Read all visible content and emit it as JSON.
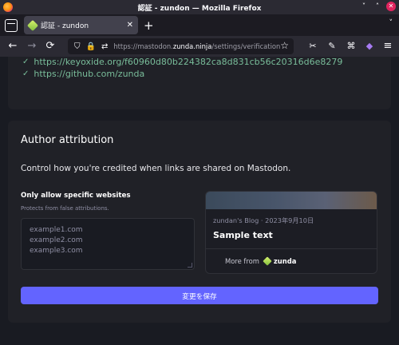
{
  "window": {
    "title": "認証 - zundon — Mozilla Firefox",
    "minimize": "˅",
    "maximize": "˄",
    "close": "✕"
  },
  "tabs": [
    {
      "title": "認証 - zundon",
      "close": "✕"
    }
  ],
  "tabstrip": {
    "new_tab": "+",
    "overflow": "˅"
  },
  "nav": {
    "back": "←",
    "forward": "→",
    "reload": "⟳",
    "url_prefix": "https://mastodon.",
    "url_host": "zunda.ninja",
    "url_path": "/settings/verification",
    "star": "☆",
    "shield": "⛉",
    "lock": "🔒",
    "perm": "⇄",
    "ext1": "✂",
    "ext2": "✎",
    "ext3": "⌘",
    "ext4": "◆",
    "menu": "≡"
  },
  "verified_links": [
    "https://keyoxide.org/f60960d80b224382ca8d831cb56c20316d6e8279",
    "https://github.com/zunda"
  ],
  "author_attribution": {
    "title": "Author attribution",
    "description": "Control how you're credited when links are shared on Mastodon.",
    "field_label": "Only allow specific websites",
    "field_hint": "Protects from false attributions.",
    "placeholder_lines": [
      "example1.com",
      "example2.com",
      "example3.com"
    ],
    "preview": {
      "meta": "zundan's Blog · 2023年9月10日",
      "title": "Sample text",
      "more_from": "More from",
      "author": "zunda"
    },
    "save_label": "変更を保存"
  },
  "colors": {
    "accent": "#6364ff",
    "verified": "#79bd9a"
  }
}
